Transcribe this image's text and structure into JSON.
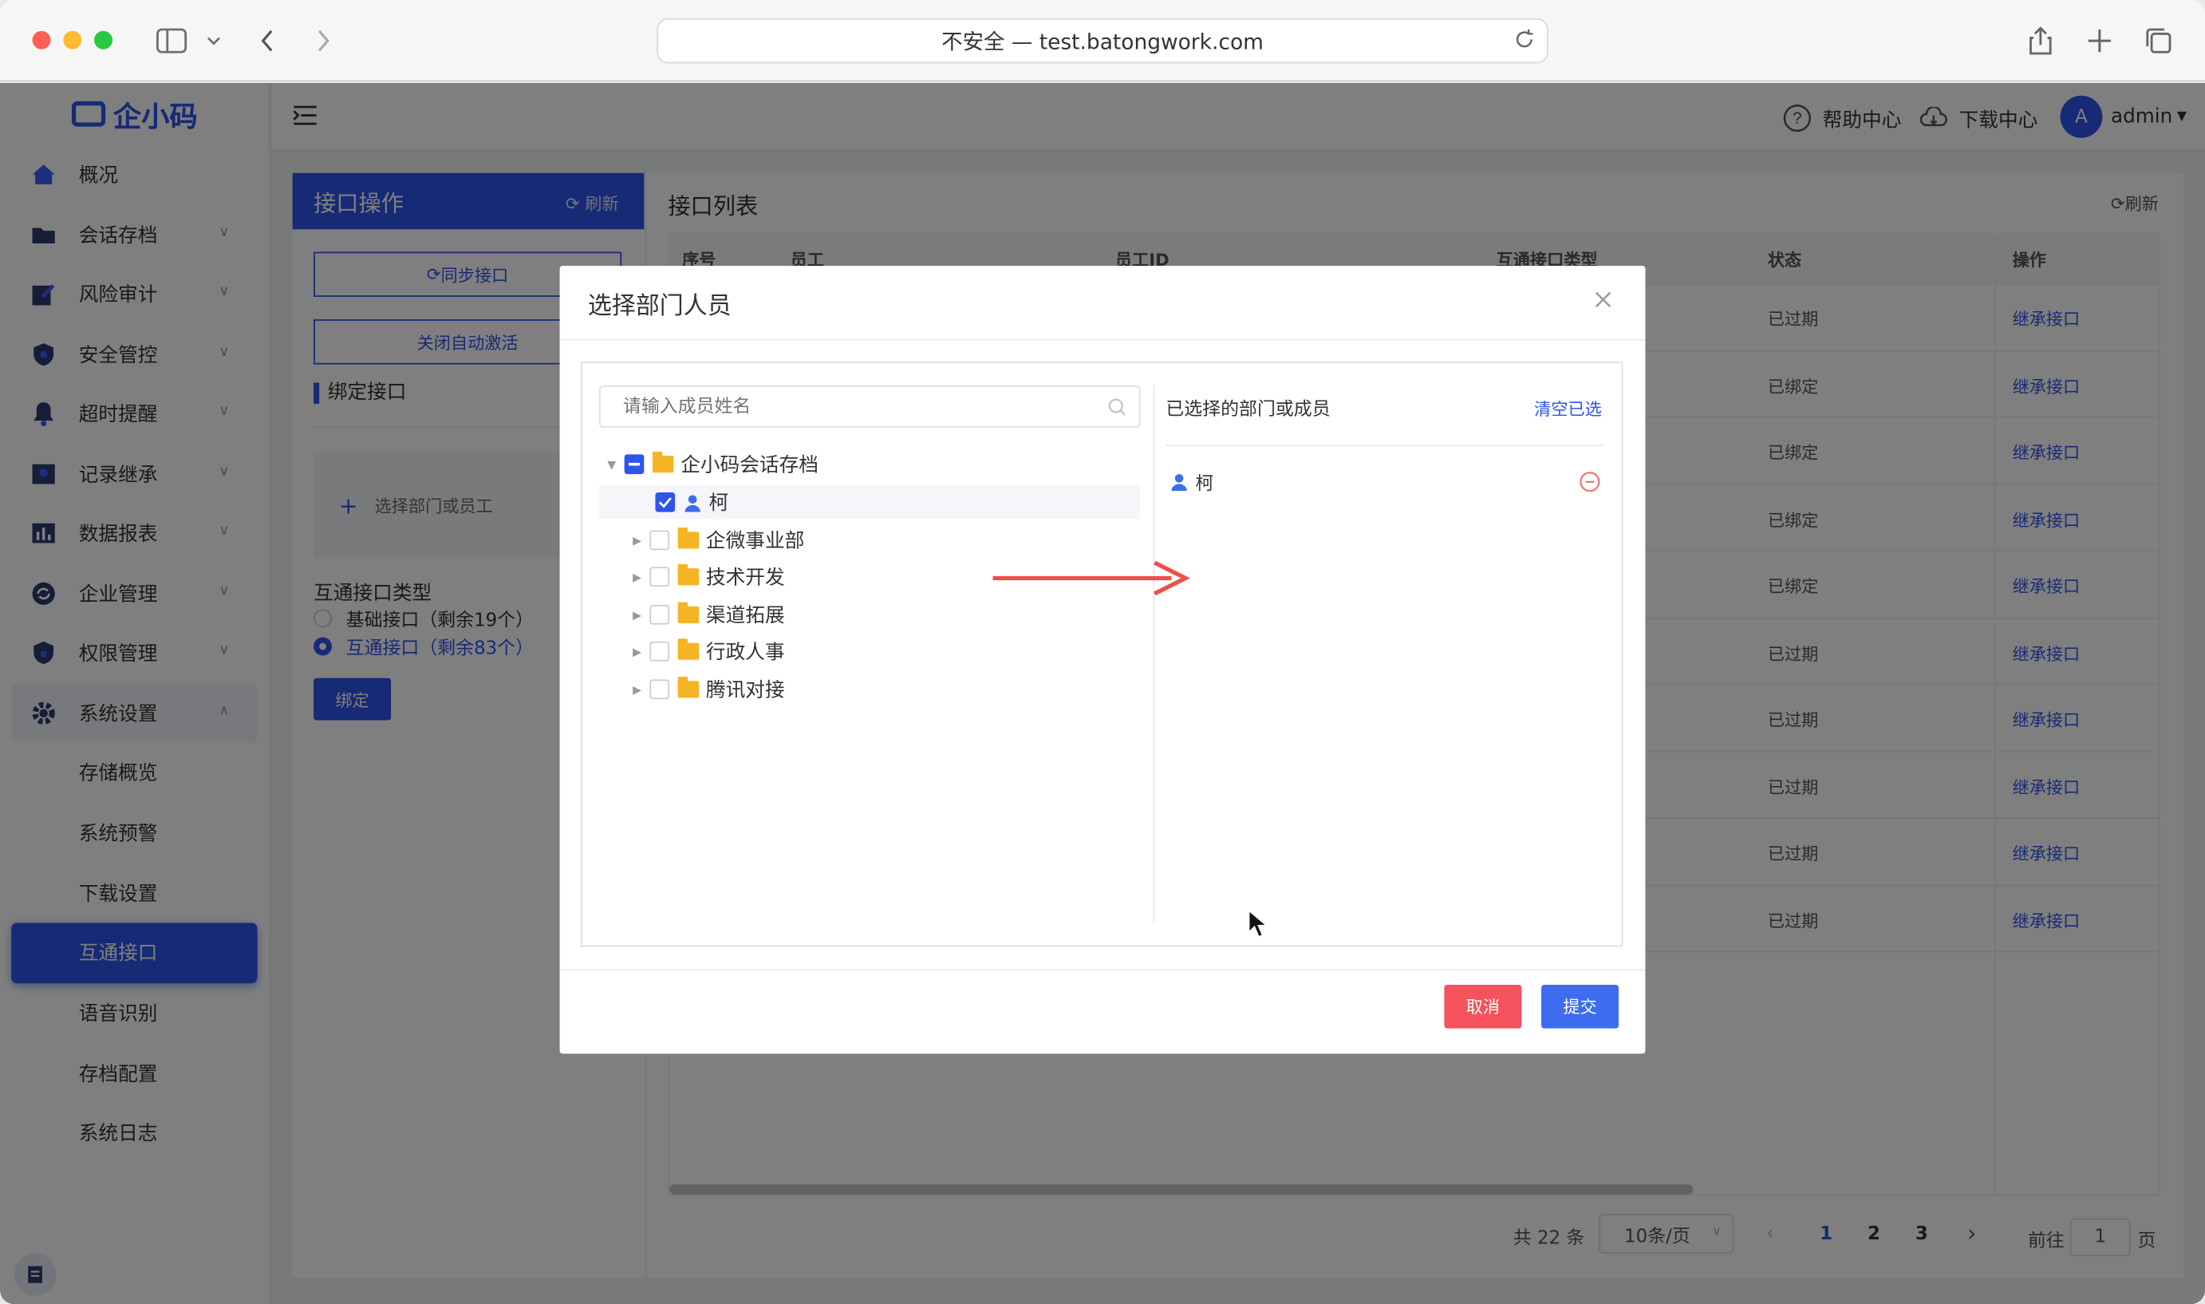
{
  "browser": {
    "address": "不安全 — test.batongwork.com"
  },
  "logo": {
    "text": "企小码"
  },
  "sidebar": {
    "items": [
      {
        "label": "概况"
      },
      {
        "label": "会话存档"
      },
      {
        "label": "风险审计"
      },
      {
        "label": "安全管控"
      },
      {
        "label": "超时提醒"
      },
      {
        "label": "记录继承"
      },
      {
        "label": "数据报表"
      },
      {
        "label": "企业管理"
      },
      {
        "label": "权限管理"
      },
      {
        "label": "系统设置"
      }
    ],
    "subitems": [
      {
        "label": "存储概览"
      },
      {
        "label": "系统预警"
      },
      {
        "label": "下载设置"
      },
      {
        "label": "互通接口"
      },
      {
        "label": "语音识别"
      },
      {
        "label": "存档配置"
      },
      {
        "label": "系统日志"
      }
    ]
  },
  "header": {
    "help": "帮助中心",
    "download": "下载中心",
    "avatar": "A",
    "user": "admin"
  },
  "left_panel": {
    "title": "接口操作",
    "refresh": "刷新",
    "sync": "同步接口",
    "close_auto": "关闭自动激活",
    "bind_section": "绑定接口",
    "select_dept": "选择部门或员工",
    "type_label": "互通接口类型",
    "option_basic": "基础接口（剩余19个）",
    "option_interop": "互通接口（剩余83个）",
    "bind_btn": "绑定"
  },
  "list_panel": {
    "title": "接口列表",
    "refresh": "刷新",
    "columns": [
      "序号",
      "员工",
      "员工ID",
      "互通接口类型",
      "状态",
      "操作"
    ],
    "rows": [
      {
        "status": "已过期",
        "action": "继承接口"
      },
      {
        "status": "已绑定",
        "action": "继承接口"
      },
      {
        "status": "已绑定",
        "action": "继承接口"
      },
      {
        "status": "已绑定",
        "action": "继承接口"
      },
      {
        "status": "已绑定",
        "action": "继承接口"
      },
      {
        "status": "已过期",
        "action": "继承接口"
      },
      {
        "status": "已过期",
        "action": "继承接口"
      },
      {
        "status": "已过期",
        "action": "继承接口"
      },
      {
        "status": "已过期",
        "action": "继承接口"
      },
      {
        "status": "已过期",
        "action": "继承接口"
      }
    ],
    "pagination": {
      "total": "共 22 条",
      "page_size": "10条/页",
      "pages": [
        "1",
        "2",
        "3"
      ],
      "goto_prefix": "前往",
      "goto_value": "1",
      "goto_suffix": "页"
    }
  },
  "modal": {
    "title": "选择部门人员",
    "search_placeholder": "请输入成员姓名",
    "tree": {
      "root": "企小码会话存档",
      "children": [
        {
          "label": "柯",
          "type": "user",
          "checked": true
        },
        {
          "label": "企微事业部",
          "type": "folder",
          "checked": false
        },
        {
          "label": "技术开发",
          "type": "folder",
          "checked": false
        },
        {
          "label": "渠道拓展",
          "type": "folder",
          "checked": false
        },
        {
          "label": "行政人事",
          "type": "folder",
          "checked": false
        },
        {
          "label": "腾讯对接",
          "type": "folder",
          "checked": false
        }
      ]
    },
    "selected_title": "已选择的部门或成员",
    "clear": "清空已选",
    "selected": [
      {
        "label": "柯"
      }
    ],
    "cancel": "取消",
    "submit": "提交"
  },
  "colors": {
    "primary": "#2f54eb",
    "cancel": "#f4525c",
    "arrow": "#ef4f4a"
  }
}
